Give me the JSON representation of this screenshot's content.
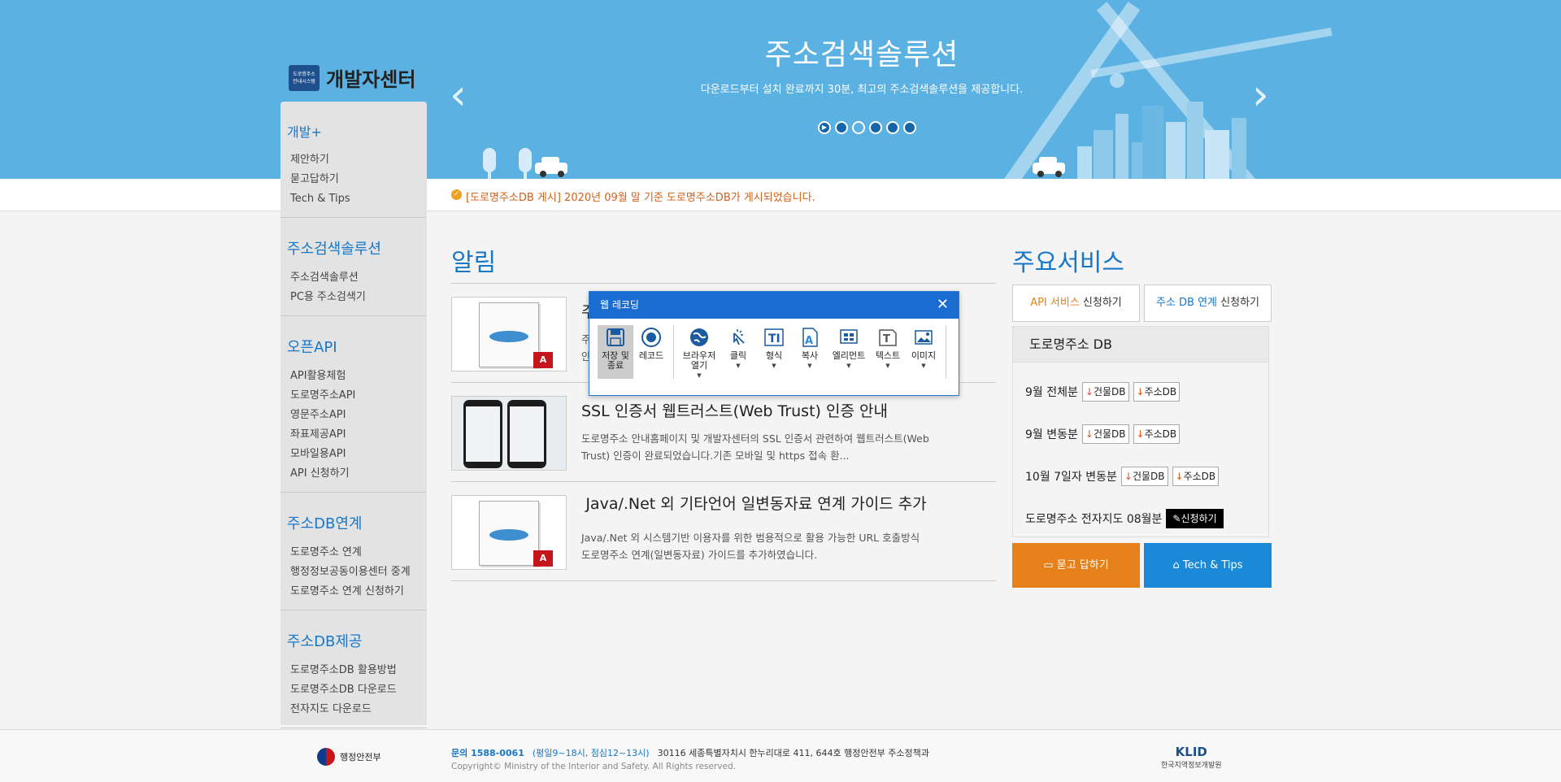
{
  "hero": {
    "title": "주소검색솔루션",
    "subtitle": "다운로드부터 설치 완료까지 30분, 최고의 주소검색솔루션을 제공합니다.",
    "prev_icon": "chevron-left-icon",
    "next_icon": "chevron-right-icon"
  },
  "logo": {
    "badge_line1": "도로명주소",
    "badge_line2": "안내시스템",
    "text": "개발자센터"
  },
  "notice_bar": {
    "text": "[도로명주소DB 게시] 2020년 09월 말 기준 도로명주소DB가 게시되었습니다."
  },
  "sidebar": {
    "groups": [
      {
        "head": "개발+",
        "items": [
          "제안하기",
          "묻고답하기",
          "Tech & Tips"
        ]
      },
      {
        "head": "주소검색솔루션",
        "items": [
          "주소검색솔루션",
          "PC용 주소검색기"
        ]
      },
      {
        "head": "오픈API",
        "items": [
          "API활용체험",
          "도로명주소API",
          "영문주소API",
          "좌표제공API",
          "모바일용API",
          "API 신청하기"
        ]
      },
      {
        "head": "주소DB연계",
        "items": [
          "도로명주소 연계",
          "행정정보공동이용센터 중계",
          "도로명주소 연계 신청하기"
        ]
      },
      {
        "head": "주소DB제공",
        "items": [
          "도로명주소DB 활용방법",
          "도로명주소DB 다운로드",
          "전자지도 다운로드"
        ]
      }
    ]
  },
  "notices": {
    "heading": "알림",
    "items": [
      {
        "title": "주",
        "desc": "주\n안"
      },
      {
        "title": "SSL 인증서 웹트러스트(Web Trust) 인증 안내",
        "desc": "도로명주소 안내홈페이지 및 개발자센터의 SSL 인증서 관련하여 웹트러스트(Web Trust) 인증이 완료되었습니다.기존 모바일 및 https 접속 환..."
      },
      {
        "title": "Java/.Net 외 기타언어 일변동자료 연계 가이드 추가",
        "desc": "Java/.Net 외 시스템기반 이용자를 위한 범용적으로 활용 가능한 URL 호출방식 도로명주소 연계(일변동자료) 가이드를 추가하였습니다."
      }
    ]
  },
  "services": {
    "heading": "주요서비스",
    "api_btn_hl": "API 서비스",
    "api_btn_rest": " 신청하기",
    "db_btn_hl": "주소 DB 연계",
    "db_btn_rest": " 신청하기",
    "db_box_title": "도로명주소 DB",
    "rows": [
      {
        "label": "9월 전체분",
        "btn1": "건물DB",
        "btn2": "주소DB"
      },
      {
        "label": "9월 변동분",
        "btn1": "건물DB",
        "btn2": "주소DB"
      },
      {
        "label": "10월 7일자 변동분",
        "btn1": "건물DB",
        "btn2": "주소DB"
      }
    ],
    "map_row_label": "도로명주소 전자지도 08월분",
    "map_apply": "신청하기",
    "qa_label": "묻고 답하기",
    "tips_label": "Tech & Tips",
    "qa_color": "#e5801a",
    "tips_color": "#1a8ad8"
  },
  "footer": {
    "gov_name": "행정안전부",
    "phone": "문의 1588-0061",
    "hours": "(평일9~18시, 점심12~13시)",
    "address": "30116 세종특별자치시 한누리대로 411, 644호 행정안전부 주소정책과",
    "copyright": "Copyright© Ministry of the Interior and Safety. All Rights reserved.",
    "klid_mark": "KLID",
    "klid_name": "한국지역정보개발원"
  },
  "recorder": {
    "title": "웹 레코딩",
    "tools": [
      {
        "label": "저장 및\n종료",
        "icon": "save-icon"
      },
      {
        "label": "레코드",
        "icon": "record-icon"
      },
      {
        "label": "브라우저\n열기",
        "icon": "globe-icon"
      },
      {
        "label": "클릭",
        "icon": "click-icon"
      },
      {
        "label": "형식",
        "icon": "type-icon"
      },
      {
        "label": "복사",
        "icon": "copy-text-icon"
      },
      {
        "label": "엘리먼트",
        "icon": "element-icon"
      },
      {
        "label": "텍스트",
        "icon": "text-icon"
      },
      {
        "label": "이미지",
        "icon": "image-icon"
      }
    ]
  },
  "colors": {
    "hero_bg": "#5bb1e2",
    "accent_blue": "#1777c9",
    "notice_orange": "#d2601a",
    "recorder_blue": "#1a6cd0"
  }
}
